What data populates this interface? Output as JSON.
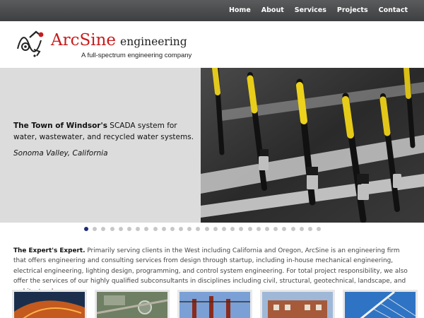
{
  "nav": {
    "items": [
      "Home",
      "About",
      "Services",
      "Projects",
      "Contact"
    ]
  },
  "logo": {
    "arc": "Arc",
    "sine": "Sine",
    "engineering": "engineering",
    "tagline": "A full-spectrum engineering company"
  },
  "hero": {
    "client_bold": "The Town of Windsor's",
    "client_rest": " SCADA system for water, wastewater, and recycled water systems.",
    "location": "Sonoma Valley, California",
    "photo_icon": "yellow-cable-connectors-photo"
  },
  "slider": {
    "total_dots": 28,
    "active_index": 0
  },
  "intro": {
    "lead": "The Expert's Expert.",
    "body": " Primarily serving clients in the West including California and Oregon, ArcSine is an engineering firm that offers engineering and consulting services from design through startup, including in-house mechanical engineering, electrical engineering, lighting design, programming, and control system engineering. For total project responsibility, we also offer the services of our highly qualified subconsultants in disciplines including civil, structural, geotechnical, landscape, and architectural."
  },
  "thumbnails": [
    "arched-building-night-photo",
    "aerial-site-photo",
    "electrical-substation-photo",
    "brick-building-photo",
    "bridge-photo"
  ],
  "colors": {
    "nav_bg": "#4a4b4d",
    "brand_red": "#c81b1b",
    "hero_bg": "#dcdcdc",
    "dot_active": "#1c2a7a",
    "dot_inactive": "#c7c7c7"
  }
}
